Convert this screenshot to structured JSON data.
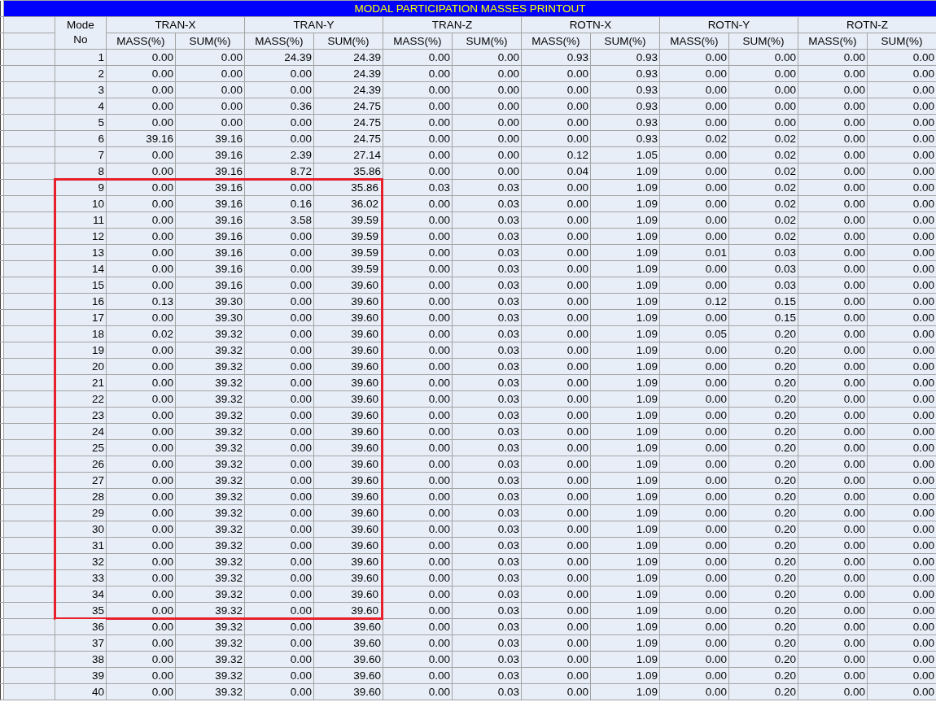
{
  "title": "MODAL PARTICIPATION MASSES PRINTOUT",
  "mode_header": "Mode No",
  "groups": [
    "TRAN-X",
    "TRAN-Y",
    "TRAN-Z",
    "ROTN-X",
    "ROTN-Y",
    "ROTN-Z"
  ],
  "subheaders": [
    "MASS(%)",
    "SUM(%)",
    "MASS(%)",
    "SUM(%)",
    "MASS(%)",
    "SUM(%)",
    "MASS(%)",
    "SUM(%)",
    "MASS(%)",
    "SUM(%)",
    "MASS(%)",
    "SUM(%)"
  ],
  "rows": [
    {
      "mode": "1",
      "highlighted": false,
      "cells": [
        "0.00",
        "0.00",
        "24.39",
        "24.39",
        "0.00",
        "0.00",
        "0.93",
        "0.93",
        "0.00",
        "0.00",
        "0.00",
        "0.00"
      ]
    },
    {
      "mode": "2",
      "highlighted": false,
      "cells": [
        "0.00",
        "0.00",
        "0.00",
        "24.39",
        "0.00",
        "0.00",
        "0.00",
        "0.93",
        "0.00",
        "0.00",
        "0.00",
        "0.00"
      ]
    },
    {
      "mode": "3",
      "highlighted": false,
      "cells": [
        "0.00",
        "0.00",
        "0.00",
        "24.39",
        "0.00",
        "0.00",
        "0.00",
        "0.93",
        "0.00",
        "0.00",
        "0.00",
        "0.00"
      ]
    },
    {
      "mode": "4",
      "highlighted": false,
      "cells": [
        "0.00",
        "0.00",
        "0.36",
        "24.75",
        "0.00",
        "0.00",
        "0.00",
        "0.93",
        "0.00",
        "0.00",
        "0.00",
        "0.00"
      ]
    },
    {
      "mode": "5",
      "highlighted": false,
      "cells": [
        "0.00",
        "0.00",
        "0.00",
        "24.75",
        "0.00",
        "0.00",
        "0.00",
        "0.93",
        "0.00",
        "0.00",
        "0.00",
        "0.00"
      ]
    },
    {
      "mode": "6",
      "highlighted": false,
      "cells": [
        "39.16",
        "39.16",
        "0.00",
        "24.75",
        "0.00",
        "0.00",
        "0.00",
        "0.93",
        "0.02",
        "0.02",
        "0.00",
        "0.00"
      ]
    },
    {
      "mode": "7",
      "highlighted": false,
      "cells": [
        "0.00",
        "39.16",
        "2.39",
        "27.14",
        "0.00",
        "0.00",
        "0.12",
        "1.05",
        "0.00",
        "0.02",
        "0.00",
        "0.00"
      ]
    },
    {
      "mode": "8",
      "highlighted": false,
      "cells": [
        "0.00",
        "39.16",
        "8.72",
        "35.86",
        "0.00",
        "0.00",
        "0.04",
        "1.09",
        "0.00",
        "0.02",
        "0.00",
        "0.00"
      ]
    },
    {
      "mode": "9",
      "highlighted": true,
      "cells": [
        "0.00",
        "39.16",
        "0.00",
        "35.86",
        "0.03",
        "0.03",
        "0.00",
        "1.09",
        "0.00",
        "0.02",
        "0.00",
        "0.00"
      ]
    },
    {
      "mode": "10",
      "highlighted": true,
      "cells": [
        "0.00",
        "39.16",
        "0.16",
        "36.02",
        "0.00",
        "0.03",
        "0.00",
        "1.09",
        "0.00",
        "0.02",
        "0.00",
        "0.00"
      ]
    },
    {
      "mode": "11",
      "highlighted": true,
      "cells": [
        "0.00",
        "39.16",
        "3.58",
        "39.59",
        "0.00",
        "0.03",
        "0.00",
        "1.09",
        "0.00",
        "0.02",
        "0.00",
        "0.00"
      ]
    },
    {
      "mode": "12",
      "highlighted": true,
      "cells": [
        "0.00",
        "39.16",
        "0.00",
        "39.59",
        "0.00",
        "0.03",
        "0.00",
        "1.09",
        "0.00",
        "0.02",
        "0.00",
        "0.00"
      ]
    },
    {
      "mode": "13",
      "highlighted": true,
      "cells": [
        "0.00",
        "39.16",
        "0.00",
        "39.59",
        "0.00",
        "0.03",
        "0.00",
        "1.09",
        "0.01",
        "0.03",
        "0.00",
        "0.00"
      ]
    },
    {
      "mode": "14",
      "highlighted": true,
      "cells": [
        "0.00",
        "39.16",
        "0.00",
        "39.59",
        "0.00",
        "0.03",
        "0.00",
        "1.09",
        "0.00",
        "0.03",
        "0.00",
        "0.00"
      ]
    },
    {
      "mode": "15",
      "highlighted": true,
      "cells": [
        "0.00",
        "39.16",
        "0.00",
        "39.60",
        "0.00",
        "0.03",
        "0.00",
        "1.09",
        "0.00",
        "0.03",
        "0.00",
        "0.00"
      ]
    },
    {
      "mode": "16",
      "highlighted": true,
      "cells": [
        "0.13",
        "39.30",
        "0.00",
        "39.60",
        "0.00",
        "0.03",
        "0.00",
        "1.09",
        "0.12",
        "0.15",
        "0.00",
        "0.00"
      ]
    },
    {
      "mode": "17",
      "highlighted": true,
      "cells": [
        "0.00",
        "39.30",
        "0.00",
        "39.60",
        "0.00",
        "0.03",
        "0.00",
        "1.09",
        "0.00",
        "0.15",
        "0.00",
        "0.00"
      ]
    },
    {
      "mode": "18",
      "highlighted": true,
      "cells": [
        "0.02",
        "39.32",
        "0.00",
        "39.60",
        "0.00",
        "0.03",
        "0.00",
        "1.09",
        "0.05",
        "0.20",
        "0.00",
        "0.00"
      ]
    },
    {
      "mode": "19",
      "highlighted": true,
      "cells": [
        "0.00",
        "39.32",
        "0.00",
        "39.60",
        "0.00",
        "0.03",
        "0.00",
        "1.09",
        "0.00",
        "0.20",
        "0.00",
        "0.00"
      ]
    },
    {
      "mode": "20",
      "highlighted": true,
      "cells": [
        "0.00",
        "39.32",
        "0.00",
        "39.60",
        "0.00",
        "0.03",
        "0.00",
        "1.09",
        "0.00",
        "0.20",
        "0.00",
        "0.00"
      ]
    },
    {
      "mode": "21",
      "highlighted": true,
      "cells": [
        "0.00",
        "39.32",
        "0.00",
        "39.60",
        "0.00",
        "0.03",
        "0.00",
        "1.09",
        "0.00",
        "0.20",
        "0.00",
        "0.00"
      ]
    },
    {
      "mode": "22",
      "highlighted": true,
      "cells": [
        "0.00",
        "39.32",
        "0.00",
        "39.60",
        "0.00",
        "0.03",
        "0.00",
        "1.09",
        "0.00",
        "0.20",
        "0.00",
        "0.00"
      ]
    },
    {
      "mode": "23",
      "highlighted": true,
      "cells": [
        "0.00",
        "39.32",
        "0.00",
        "39.60",
        "0.00",
        "0.03",
        "0.00",
        "1.09",
        "0.00",
        "0.20",
        "0.00",
        "0.00"
      ]
    },
    {
      "mode": "24",
      "highlighted": true,
      "cells": [
        "0.00",
        "39.32",
        "0.00",
        "39.60",
        "0.00",
        "0.03",
        "0.00",
        "1.09",
        "0.00",
        "0.20",
        "0.00",
        "0.00"
      ]
    },
    {
      "mode": "25",
      "highlighted": true,
      "cells": [
        "0.00",
        "39.32",
        "0.00",
        "39.60",
        "0.00",
        "0.03",
        "0.00",
        "1.09",
        "0.00",
        "0.20",
        "0.00",
        "0.00"
      ]
    },
    {
      "mode": "26",
      "highlighted": true,
      "cells": [
        "0.00",
        "39.32",
        "0.00",
        "39.60",
        "0.00",
        "0.03",
        "0.00",
        "1.09",
        "0.00",
        "0.20",
        "0.00",
        "0.00"
      ]
    },
    {
      "mode": "27",
      "highlighted": true,
      "cells": [
        "0.00",
        "39.32",
        "0.00",
        "39.60",
        "0.00",
        "0.03",
        "0.00",
        "1.09",
        "0.00",
        "0.20",
        "0.00",
        "0.00"
      ]
    },
    {
      "mode": "28",
      "highlighted": true,
      "cells": [
        "0.00",
        "39.32",
        "0.00",
        "39.60",
        "0.00",
        "0.03",
        "0.00",
        "1.09",
        "0.00",
        "0.20",
        "0.00",
        "0.00"
      ]
    },
    {
      "mode": "29",
      "highlighted": true,
      "cells": [
        "0.00",
        "39.32",
        "0.00",
        "39.60",
        "0.00",
        "0.03",
        "0.00",
        "1.09",
        "0.00",
        "0.20",
        "0.00",
        "0.00"
      ]
    },
    {
      "mode": "30",
      "highlighted": true,
      "cells": [
        "0.00",
        "39.32",
        "0.00",
        "39.60",
        "0.00",
        "0.03",
        "0.00",
        "1.09",
        "0.00",
        "0.20",
        "0.00",
        "0.00"
      ]
    },
    {
      "mode": "31",
      "highlighted": true,
      "cells": [
        "0.00",
        "39.32",
        "0.00",
        "39.60",
        "0.00",
        "0.03",
        "0.00",
        "1.09",
        "0.00",
        "0.20",
        "0.00",
        "0.00"
      ]
    },
    {
      "mode": "32",
      "highlighted": true,
      "cells": [
        "0.00",
        "39.32",
        "0.00",
        "39.60",
        "0.00",
        "0.03",
        "0.00",
        "1.09",
        "0.00",
        "0.20",
        "0.00",
        "0.00"
      ]
    },
    {
      "mode": "33",
      "highlighted": true,
      "cells": [
        "0.00",
        "39.32",
        "0.00",
        "39.60",
        "0.00",
        "0.03",
        "0.00",
        "1.09",
        "0.00",
        "0.20",
        "0.00",
        "0.00"
      ]
    },
    {
      "mode": "34",
      "highlighted": true,
      "cells": [
        "0.00",
        "39.32",
        "0.00",
        "39.60",
        "0.00",
        "0.03",
        "0.00",
        "1.09",
        "0.00",
        "0.20",
        "0.00",
        "0.00"
      ]
    },
    {
      "mode": "35",
      "highlighted": true,
      "cells": [
        "0.00",
        "39.32",
        "0.00",
        "39.60",
        "0.00",
        "0.03",
        "0.00",
        "1.09",
        "0.00",
        "0.20",
        "0.00",
        "0.00"
      ]
    },
    {
      "mode": "36",
      "highlighted": false,
      "cells": [
        "0.00",
        "39.32",
        "0.00",
        "39.60",
        "0.00",
        "0.03",
        "0.00",
        "1.09",
        "0.00",
        "0.20",
        "0.00",
        "0.00"
      ]
    },
    {
      "mode": "37",
      "highlighted": false,
      "cells": [
        "0.00",
        "39.32",
        "0.00",
        "39.60",
        "0.00",
        "0.03",
        "0.00",
        "1.09",
        "0.00",
        "0.20",
        "0.00",
        "0.00"
      ]
    },
    {
      "mode": "38",
      "highlighted": false,
      "cells": [
        "0.00",
        "39.32",
        "0.00",
        "39.60",
        "0.00",
        "0.03",
        "0.00",
        "1.09",
        "0.00",
        "0.20",
        "0.00",
        "0.00"
      ]
    },
    {
      "mode": "39",
      "highlighted": false,
      "cells": [
        "0.00",
        "39.32",
        "0.00",
        "39.60",
        "0.00",
        "0.03",
        "0.00",
        "1.09",
        "0.00",
        "0.20",
        "0.00",
        "0.00"
      ]
    },
    {
      "mode": "40",
      "highlighted": false,
      "cells": [
        "0.00",
        "39.32",
        "0.00",
        "39.60",
        "0.00",
        "0.03",
        "0.00",
        "1.09",
        "0.00",
        "0.20",
        "0.00",
        "0.00"
      ]
    }
  ]
}
